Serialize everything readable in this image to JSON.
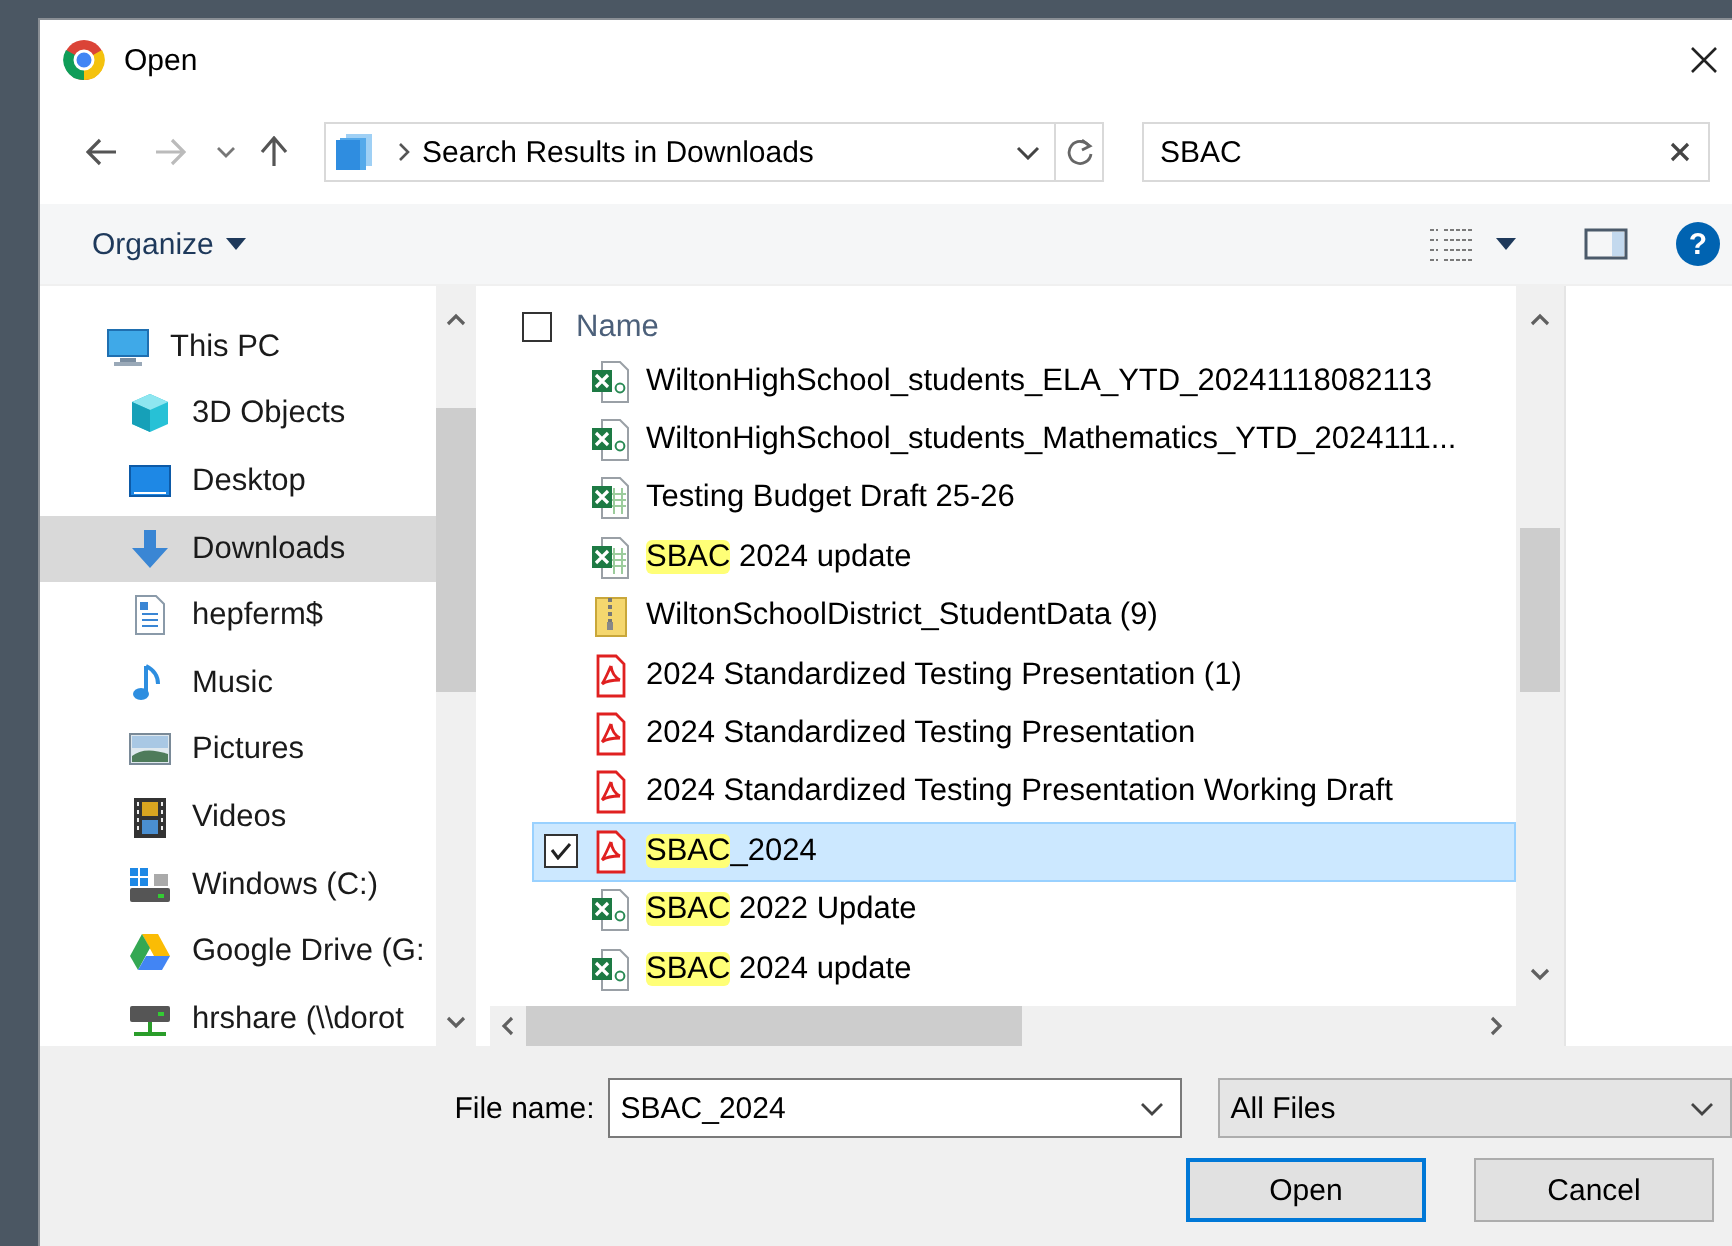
{
  "window": {
    "title": "Open"
  },
  "address_bar": {
    "path": "Search Results in Downloads"
  },
  "search": {
    "value": "SBAC"
  },
  "command_bar": {
    "organize": "Organize",
    "help": "?"
  },
  "nav_pane": {
    "items": [
      {
        "label": "This PC",
        "kind": "pc",
        "selected": false,
        "children": [
          {
            "label": "3D Objects",
            "kind": "objects",
            "selected": false
          },
          {
            "label": "Desktop",
            "kind": "desktop",
            "selected": false
          },
          {
            "label": "Downloads",
            "kind": "downloads",
            "selected": true
          },
          {
            "label": "hepferm$",
            "kind": "document",
            "selected": false
          },
          {
            "label": "Music",
            "kind": "music",
            "selected": false
          },
          {
            "label": "Pictures",
            "kind": "pictures",
            "selected": false
          },
          {
            "label": "Videos",
            "kind": "videos",
            "selected": false
          },
          {
            "label": "Windows (C:)",
            "kind": "drive",
            "selected": false
          },
          {
            "label": "Google Drive (G:",
            "kind": "cloud",
            "selected": false
          },
          {
            "label": "hrshare (\\\\dorot",
            "kind": "network",
            "selected": false
          }
        ]
      }
    ]
  },
  "file_list": {
    "column": "Name",
    "all_checked": false,
    "rows": [
      {
        "kind": "csv",
        "selected": false,
        "checked": false,
        "parts": [
          {
            "text": "WiltonHighSchool_students_ELA_YTD_20241118082113",
            "highlighted": false
          }
        ]
      },
      {
        "kind": "csv",
        "selected": false,
        "checked": false,
        "parts": [
          {
            "text": "WiltonHighSchool_students_Mathematics_YTD_2024111...",
            "highlighted": false
          }
        ]
      },
      {
        "kind": "xlsx",
        "selected": false,
        "checked": false,
        "parts": [
          {
            "text": "Testing Budget Draft  25-26",
            "highlighted": false
          }
        ]
      },
      {
        "kind": "xlsx",
        "selected": false,
        "checked": false,
        "parts": [
          {
            "text": "SBAC",
            "highlighted": true
          },
          {
            "text": " 2024 update",
            "highlighted": false
          }
        ]
      },
      {
        "kind": "zip",
        "selected": false,
        "checked": false,
        "parts": [
          {
            "text": "WiltonSchoolDistrict_StudentData (9)",
            "highlighted": false
          }
        ]
      },
      {
        "kind": "pdf",
        "selected": false,
        "checked": false,
        "parts": [
          {
            "text": "2024 Standardized Testing Presentation (1)",
            "highlighted": false
          }
        ]
      },
      {
        "kind": "pdf",
        "selected": false,
        "checked": false,
        "parts": [
          {
            "text": "2024 Standardized Testing Presentation",
            "highlighted": false
          }
        ]
      },
      {
        "kind": "pdf",
        "selected": false,
        "checked": false,
        "parts": [
          {
            "text": "2024 Standardized Testing Presentation Working Draft",
            "highlighted": false
          }
        ]
      },
      {
        "kind": "pdf",
        "selected": true,
        "checked": true,
        "parts": [
          {
            "text": "SBAC",
            "highlighted": true
          },
          {
            "text": "_2024",
            "highlighted": false
          }
        ]
      },
      {
        "kind": "csv",
        "selected": false,
        "checked": false,
        "parts": [
          {
            "text": "SBAC",
            "highlighted": true
          },
          {
            "text": " 2022 Update",
            "highlighted": false
          }
        ]
      },
      {
        "kind": "csv",
        "selected": false,
        "checked": false,
        "parts": [
          {
            "text": "SBAC",
            "highlighted": true
          },
          {
            "text": " 2024 update",
            "highlighted": false
          }
        ]
      }
    ]
  },
  "footer": {
    "file_name_label": "File name:",
    "file_name": "SBAC_2024",
    "file_type": "All Files",
    "buttons": [
      {
        "label": "Open",
        "default": true
      },
      {
        "label": "Cancel",
        "default": false
      }
    ]
  }
}
